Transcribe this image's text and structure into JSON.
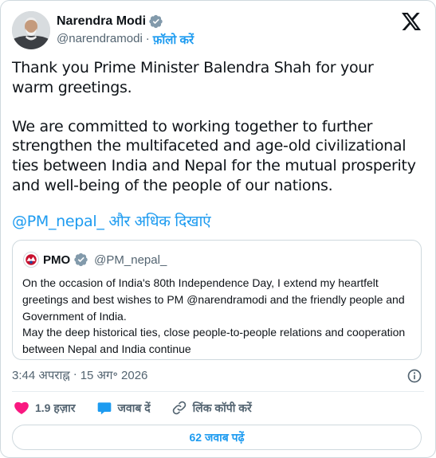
{
  "author": {
    "name": "Narendra Modi",
    "handle": "@narendramodi",
    "separator": "·",
    "follow_label": "फ़ॉलो करें"
  },
  "tweet": {
    "text": "Thank you Prime Minister Balendra Shah for your warm greetings.\n\nWe are committed to working together to further strengthen the multifaceted and age-old civilizational ties between India and Nepal for the mutual prosperity and well-being of the people of our nations.",
    "mention": "@PM_nepal_",
    "show_more": "और अधिक दिखाएं"
  },
  "quote": {
    "name": "PMO",
    "handle": "@PM_nepal_",
    "text": "On the occasion of India's 80th Independence Day, I extend my heartfelt greetings and best wishes to PM @narendramodi and the friendly people and Government of India.\nMay the deep historical ties, close people-to-people relations and cooperation between Nepal and India continue"
  },
  "meta": {
    "time": "3:44 अपराह्न",
    "separator": "·",
    "date": "15 अग॰ 2026"
  },
  "actions": {
    "likes": "1.9 हज़ार",
    "reply_label": "जवाब दें",
    "copy_link_label": "लिंक कॉपी करें"
  },
  "replies_button": "62 जवाब पढ़ें",
  "colors": {
    "accent": "#1d9bf0",
    "like": "#f91880",
    "verified": "#829aab",
    "muted": "#536471"
  },
  "icons": {
    "verified": "verified-badge-icon",
    "logo": "x-logo-icon",
    "info": "info-icon",
    "like": "heart-icon",
    "reply": "reply-bubble-icon",
    "copy": "link-icon"
  }
}
